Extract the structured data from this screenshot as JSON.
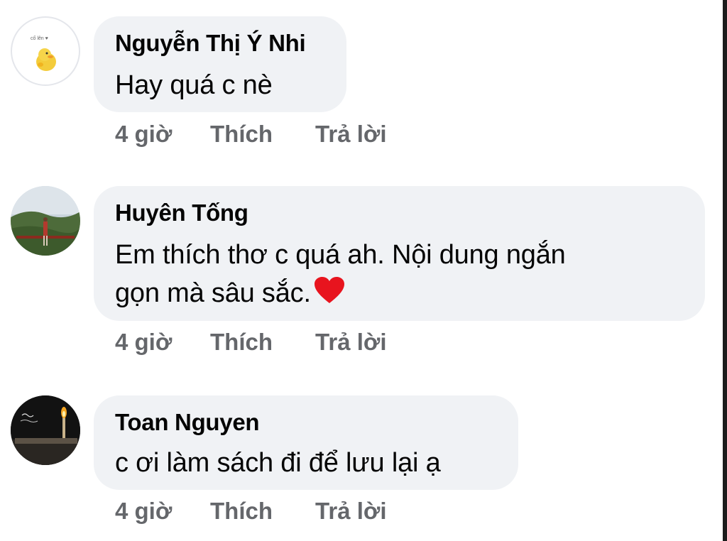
{
  "comments": [
    {
      "author": "Nguyễn Thị Ý Nhi",
      "text": "Hay quá c nè",
      "time": "4 giờ",
      "like_label": "Thích",
      "reply_label": "Trả lời",
      "avatar_caption": "cố lên ♥"
    },
    {
      "author": "Huyên Tống",
      "text_line1": "Em thích thơ c quá ah. Nội dung ngắn",
      "text_line2": "gọn mà sâu sắc.",
      "emoji": "red-heart",
      "time": "4 giờ",
      "like_label": "Thích",
      "reply_label": "Trả lời"
    },
    {
      "author": "Toan Nguyen",
      "text": "c ơi làm sách đi để lưu lại ạ",
      "time": "4 giờ",
      "like_label": "Thích",
      "reply_label": "Trả lời"
    }
  ],
  "colors": {
    "bubble": "#f0f2f5",
    "action_text": "#65676b",
    "heart": "#e8141e"
  }
}
